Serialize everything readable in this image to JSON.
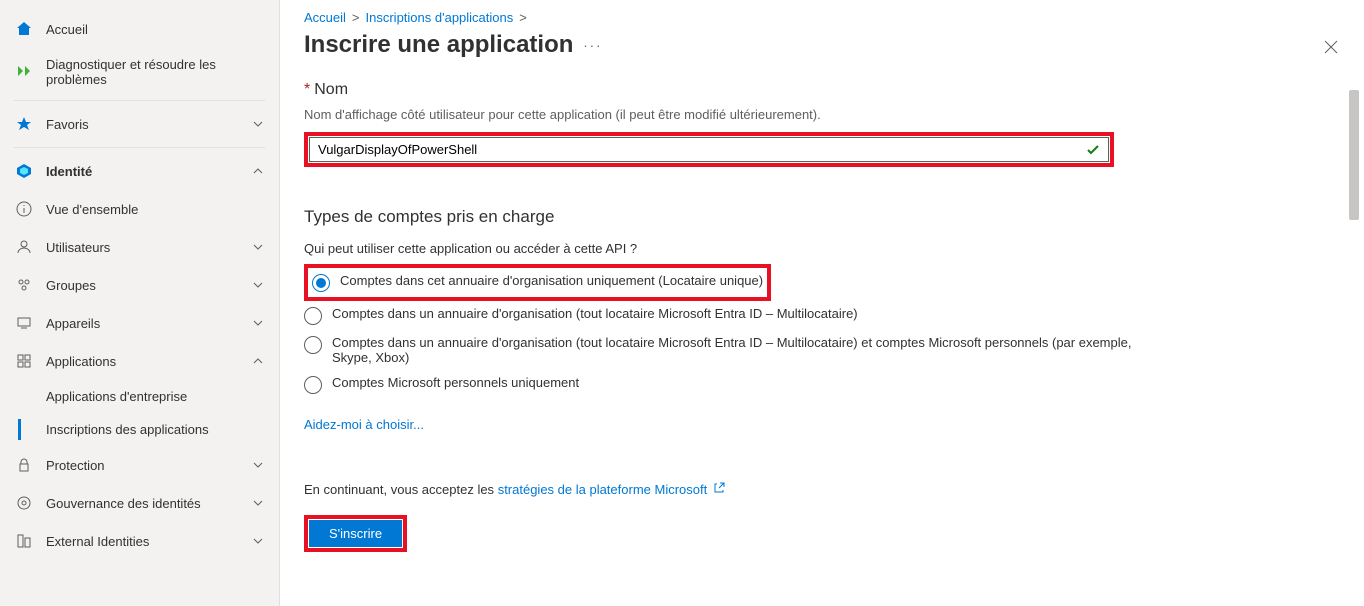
{
  "sidebar": {
    "home": "Accueil",
    "diagnose": "Diagnostiquer et résoudre les problèmes",
    "favorites": "Favoris",
    "identity": "Identité",
    "overview": "Vue d'ensemble",
    "users": "Utilisateurs",
    "groups": "Groupes",
    "devices": "Appareils",
    "applications": "Applications",
    "enterprise_apps": "Applications d'entreprise",
    "app_registrations": "Inscriptions des applications",
    "protection": "Protection",
    "id_governance": "Gouvernance des identités",
    "external": "External Identities"
  },
  "breadcrumb": {
    "home": "Accueil",
    "appregs": "Inscriptions d'applications",
    "sep": ">"
  },
  "page_title": "Inscrire une application",
  "name_section": {
    "label": "Nom",
    "help": "Nom d'affichage côté utilisateur pour cette application (il peut être modifié ultérieurement).",
    "value": "VulgarDisplayOfPowerShell"
  },
  "acct_section": {
    "title": "Types de comptes pris en charge",
    "sub": "Qui peut utiliser cette application ou accéder à cette API ?",
    "opt1": "Comptes dans cet annuaire d'organisation uniquement (Locataire unique)",
    "opt2": "Comptes dans un annuaire d'organisation (tout locataire Microsoft Entra ID – Multilocataire)",
    "opt3": "Comptes dans un annuaire d'organisation (tout locataire Microsoft Entra ID – Multilocataire) et comptes Microsoft personnels (par exemple, Skype, Xbox)",
    "opt4": "Comptes Microsoft personnels uniquement",
    "help_link": "Aidez-moi à choisir..."
  },
  "footer": {
    "consent_pre": "En continuant, vous acceptez les ",
    "consent_link": "stratégies de la plateforme Microsoft",
    "register": "S'inscrire"
  }
}
